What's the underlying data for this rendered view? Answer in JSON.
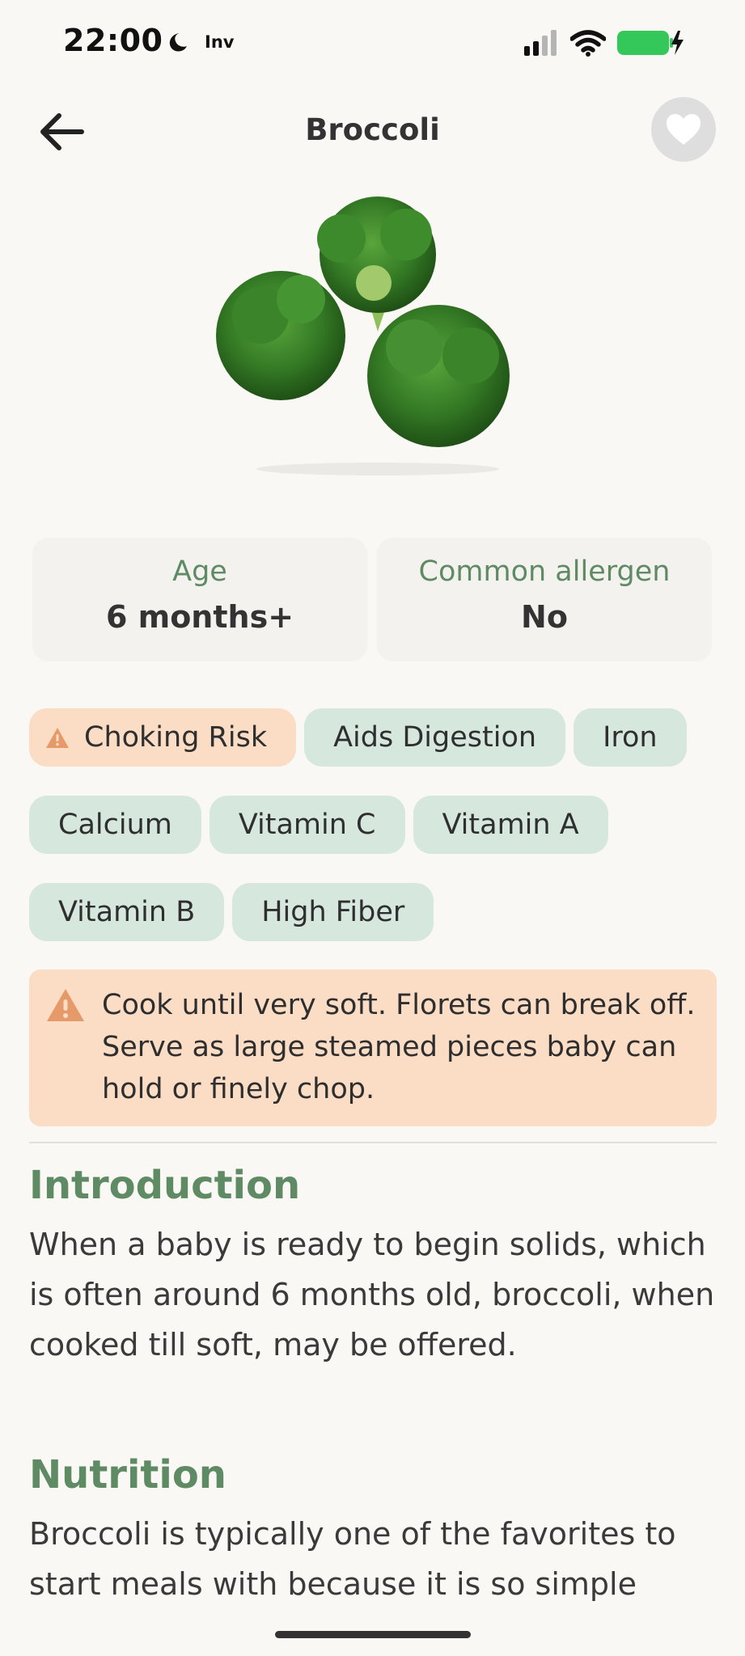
{
  "status": {
    "time": "22:00",
    "app_label": "Inv",
    "icons": [
      "moon-icon",
      "signal-icon",
      "wifi-icon",
      "battery-charging-icon"
    ],
    "battery_color": "#34c759"
  },
  "header": {
    "back_icon": "arrow-left-icon",
    "title": "Broccoli",
    "favorite_icon": "heart-icon"
  },
  "hero": {
    "image": "broccoli-image"
  },
  "info": {
    "age_label": "Age",
    "age_value": "6 months+",
    "allergen_label": "Common allergen",
    "allergen_value": "No"
  },
  "tags": [
    {
      "label": "Choking Risk",
      "warning": true
    },
    {
      "label": "Aids Digestion"
    },
    {
      "label": "Iron"
    },
    {
      "label": "Calcium"
    },
    {
      "label": "Vitamin C"
    },
    {
      "label": "Vitamin A"
    },
    {
      "label": "Vitamin B"
    },
    {
      "label": "High Fiber"
    }
  ],
  "warning": {
    "icon": "warning-triangle-icon",
    "text": "Cook until very soft. Florets can break off. Serve as large steamed pieces baby can hold or finely chop."
  },
  "introduction": {
    "title": "Introduction",
    "body": "When a baby is ready to begin solids, which is often around 6 months old, broccoli, when cooked till soft, may be offered."
  },
  "nutrition": {
    "title": "Nutrition",
    "body": "Broccoli is typically one of the favorites to start meals with because it is so simple"
  },
  "colors": {
    "accent_green": "#5f8b64",
    "tag_green": "#d6e7de",
    "warning_bg": "#fbdcc4",
    "warning_icon": "#e69a6a",
    "background": "#faf8f5"
  }
}
